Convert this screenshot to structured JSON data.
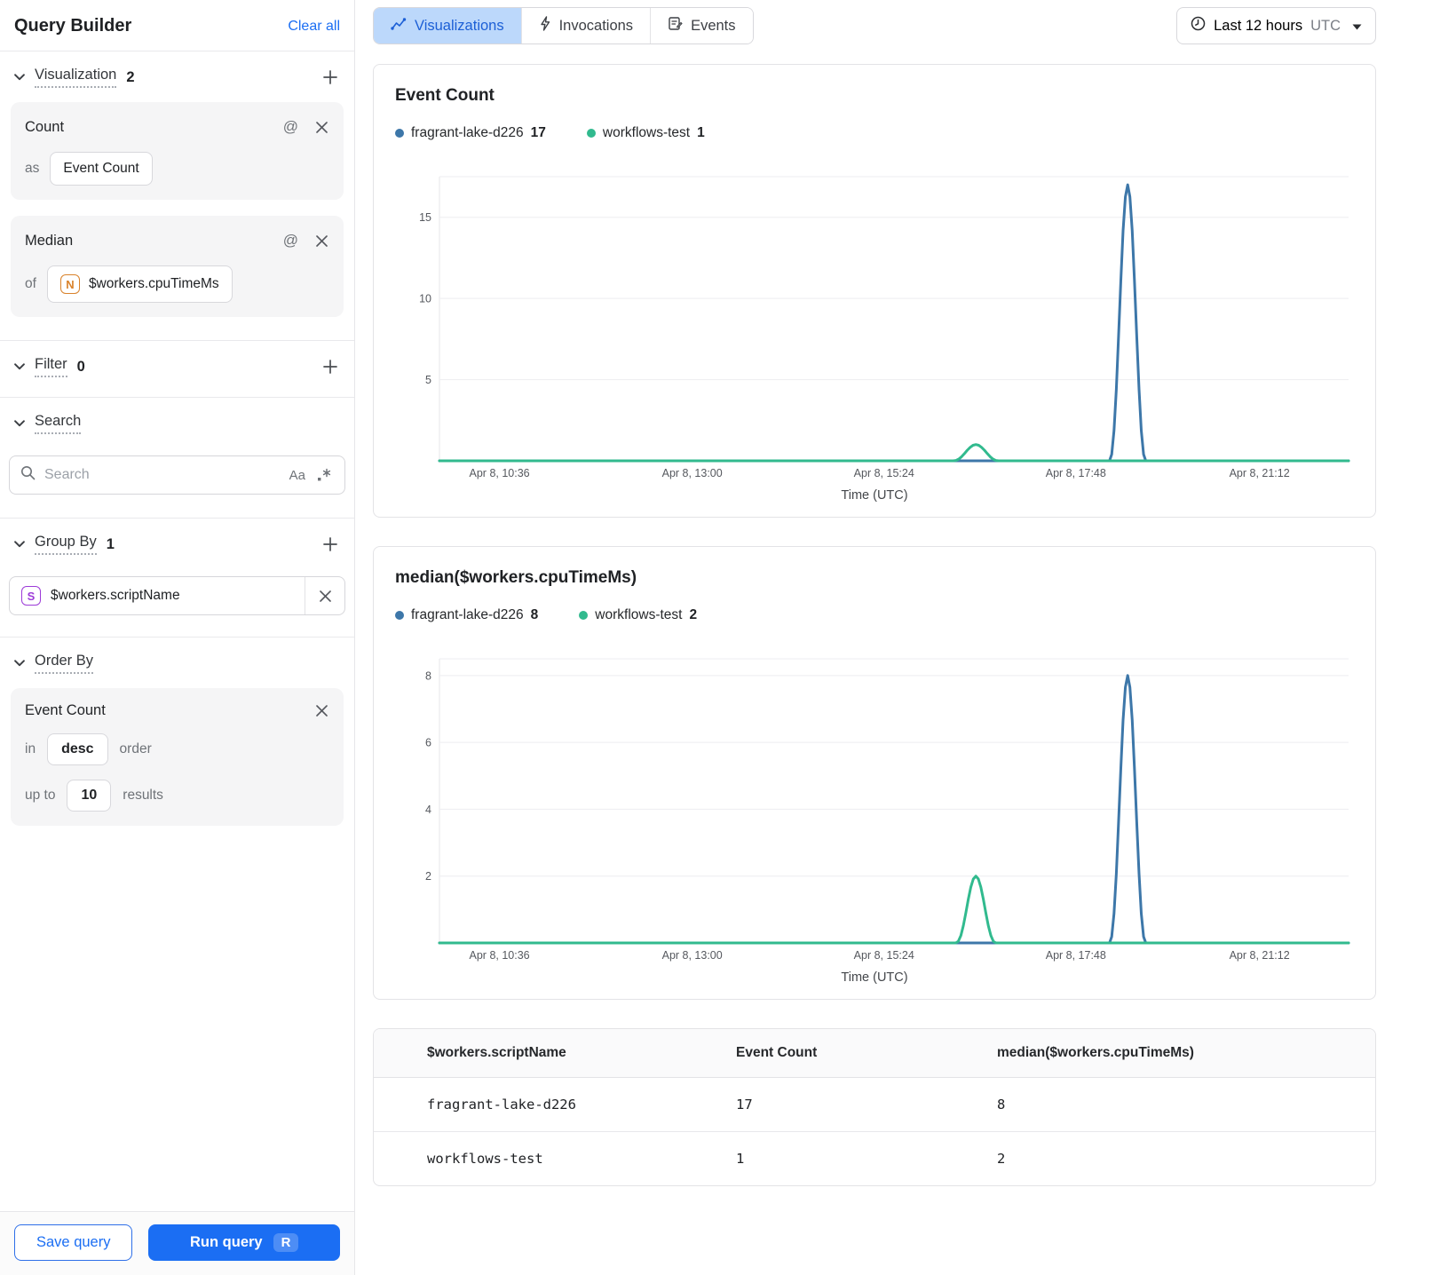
{
  "sidebar": {
    "title": "Query Builder",
    "clear_all_label": "Clear all",
    "sections": {
      "visualization": {
        "label": "Visualization",
        "count": "2"
      },
      "filter": {
        "label": "Filter",
        "count": "0"
      },
      "search": {
        "label": "Search"
      },
      "group_by": {
        "label": "Group By",
        "count": "1"
      },
      "order_by": {
        "label": "Order By"
      }
    },
    "count_card": {
      "title": "Count",
      "as_label": "as",
      "value": "Event Count"
    },
    "median_card": {
      "title": "Median",
      "of_label": "of",
      "badge": "N",
      "value": "$workers.cpuTimeMs"
    },
    "search_box": {
      "placeholder": "Search",
      "case_toggle": "Aa"
    },
    "group_by_value": {
      "badge": "S",
      "value": "$workers.scriptName"
    },
    "order_card": {
      "field": "Event Count",
      "in_label": "in",
      "direction": "desc",
      "order_label": "order",
      "up_to_label": "up to",
      "limit": "10",
      "results_label": "results"
    },
    "save_button": "Save query",
    "run_button": "Run query",
    "run_shortcut": "R"
  },
  "header": {
    "tabs": [
      {
        "label": "Visualizations"
      },
      {
        "label": "Invocations"
      },
      {
        "label": "Events"
      }
    ],
    "time_range": {
      "label": "Last 12 hours",
      "zone": "UTC"
    }
  },
  "colors": {
    "accent": "#1b6ef3",
    "tab_active_bg": "#bcd8fb",
    "series_blue": "#3d77a9",
    "series_green": "#31ba8e"
  },
  "chart_data": [
    {
      "type": "line",
      "title": "Event Count",
      "xlabel": "Time (UTC)",
      "x_ticks": [
        {
          "label": "Apr 8, 10:36",
          "frac": 0.066
        },
        {
          "label": "Apr 8, 13:00",
          "frac": 0.278
        },
        {
          "label": "Apr 8, 15:24",
          "frac": 0.489
        },
        {
          "label": "Apr 8, 17:48",
          "frac": 0.7
        },
        {
          "label": "Apr 8, 21:12",
          "frac": 0.902
        }
      ],
      "y_ticks": [
        5,
        10,
        15
      ],
      "ymax": 17.5,
      "grid": true,
      "legend_position": "top",
      "series": [
        {
          "name": "fragrant-lake-d226",
          "total": 17,
          "color": "#3d77a9",
          "baseline": 0,
          "peaks": [
            {
              "frac": 0.757,
              "value": 17,
              "half_width": 0.02,
              "approx_time": "Apr 8, ~18:30"
            }
          ]
        },
        {
          "name": "workflows-test",
          "total": 1,
          "color": "#31ba8e",
          "baseline": 0,
          "peaks": [
            {
              "frac": 0.59,
              "value": 1,
              "half_width": 0.025,
              "approx_time": "Apr 8, ~16:30"
            }
          ]
        }
      ]
    },
    {
      "type": "line",
      "title": "median($workers.cpuTimeMs)",
      "xlabel": "Time (UTC)",
      "x_ticks": [
        {
          "label": "Apr 8, 10:36",
          "frac": 0.066
        },
        {
          "label": "Apr 8, 13:00",
          "frac": 0.278
        },
        {
          "label": "Apr 8, 15:24",
          "frac": 0.489
        },
        {
          "label": "Apr 8, 17:48",
          "frac": 0.7
        },
        {
          "label": "Apr 8, 21:12",
          "frac": 0.902
        }
      ],
      "y_ticks": [
        2,
        4,
        6,
        8
      ],
      "ymax": 8.5,
      "grid": true,
      "legend_position": "top",
      "series": [
        {
          "name": "fragrant-lake-d226",
          "total": 8,
          "color": "#3d77a9",
          "baseline": 0,
          "peaks": [
            {
              "frac": 0.757,
              "value": 8,
              "half_width": 0.02,
              "approx_time": "Apr 8, ~18:30"
            }
          ]
        },
        {
          "name": "workflows-test",
          "total": 2,
          "color": "#31ba8e",
          "baseline": 0,
          "peaks": [
            {
              "frac": 0.59,
              "value": 2,
              "half_width": 0.022,
              "approx_time": "Apr 8, ~16:30"
            }
          ]
        }
      ]
    }
  ],
  "table": {
    "columns": [
      "$workers.scriptName",
      "Event Count",
      "median($workers.cpuTimeMs)"
    ],
    "rows": [
      {
        "color": "#3d77a9",
        "name": "fragrant-lake-d226",
        "event_count": "17",
        "median": "8"
      },
      {
        "color": "#31ba8e",
        "name": "workflows-test",
        "event_count": "1",
        "median": "2"
      }
    ]
  }
}
